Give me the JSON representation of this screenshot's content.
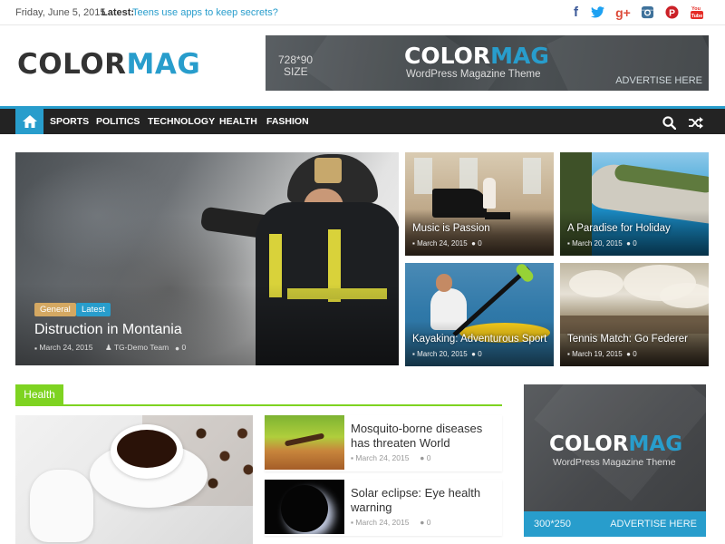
{
  "topbar": {
    "date": "Friday, June 5, 2015",
    "latest_label": "Latest:",
    "latest_link": "Teens use apps to keep secrets?",
    "social": [
      {
        "icon": "facebook-icon",
        "glyph": "f",
        "color": "#3b5998"
      },
      {
        "icon": "twitter-icon",
        "glyph": "t",
        "color": "#1da1f2"
      },
      {
        "icon": "google-plus-icon",
        "glyph": "g+",
        "color": "#dd4b39"
      },
      {
        "icon": "instagram-icon",
        "glyph": "◙",
        "color": "#3f729b"
      },
      {
        "icon": "pinterest-icon",
        "glyph": "P",
        "color": "#cb2027"
      },
      {
        "icon": "youtube-icon",
        "glyph": "▶",
        "color": "#e52d27"
      }
    ]
  },
  "header": {
    "logo_part1": "COLOR",
    "logo_part2": "MAG",
    "ad": {
      "size_line1": "728*90",
      "size_line2": "SIZE",
      "logo_part1": "COLOR",
      "logo_part2": "MAG",
      "tagline": "WordPress Magazine Theme",
      "cta": "ADVERTISE HERE"
    }
  },
  "nav": {
    "items": [
      "SPORTS",
      "POLITICS",
      "TECHNOLOGY",
      "HEALTH",
      "FASHION"
    ],
    "accent": "#289dcc"
  },
  "featured": {
    "main": {
      "badges": [
        "General",
        "Latest"
      ],
      "title": "Distruction in Montania",
      "date": "March 24, 2015",
      "author": "TG-Demo Team",
      "comments": "0"
    },
    "cards": [
      {
        "title": "Music is Passion",
        "date": "March 24, 2015",
        "comments": "0"
      },
      {
        "title": "A Paradise for Holiday",
        "date": "March 20, 2015",
        "comments": "0"
      },
      {
        "title": "Kayaking: Adventurous Sport",
        "date": "March 20, 2015",
        "comments": "0"
      },
      {
        "title": "Tennis Match: Go Federer",
        "date": "March 19, 2015",
        "comments": "0"
      }
    ]
  },
  "health": {
    "section_label": "Health",
    "accent": "#7ed321",
    "news": [
      {
        "title": "Mosquito-borne diseases has threaten World",
        "date": "March 24, 2015",
        "comments": "0"
      },
      {
        "title": "Solar eclipse: Eye health warning",
        "date": "March 24, 2015",
        "comments": "0"
      }
    ]
  },
  "sidead": {
    "logo_part1": "COLOR",
    "logo_part2": "MAG",
    "tagline": "WordPress Magazine Theme",
    "size": "300*250",
    "cta": "ADVERTISE HERE"
  }
}
